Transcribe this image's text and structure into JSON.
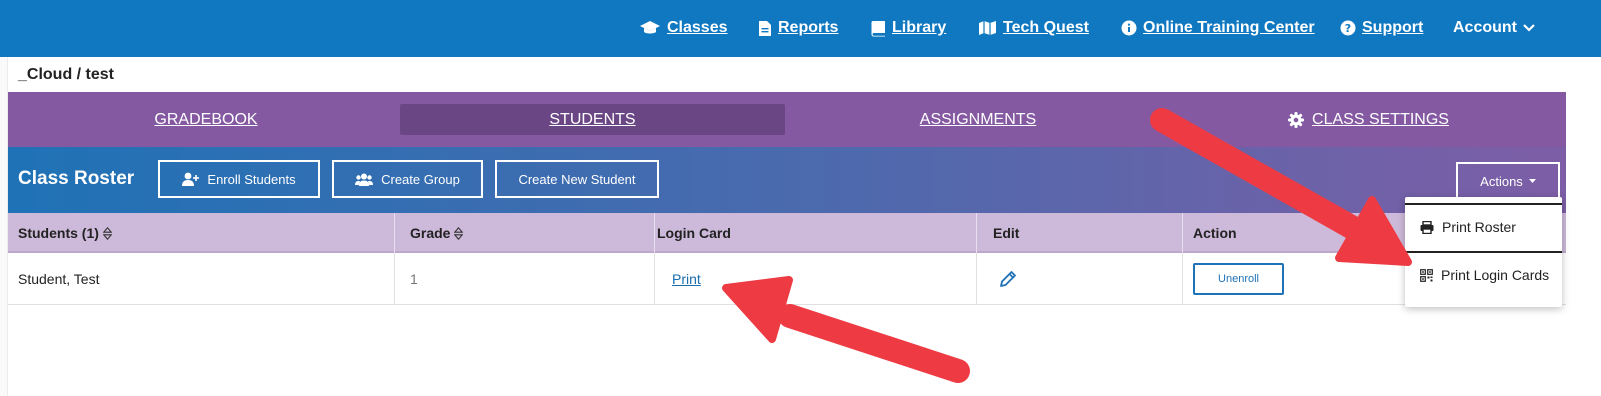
{
  "nav": {
    "classes": "Classes",
    "reports": "Reports",
    "library": "Library",
    "tech_quest": "Tech Quest",
    "training": "Online Training Center",
    "support": "Support",
    "account": "Account"
  },
  "breadcrumb": "_Cloud / test",
  "tabs": {
    "gradebook": "GRADEBOOK",
    "students": "STUDENTS",
    "assignments": "ASSIGNMENTS",
    "settings": "CLASS SETTINGS"
  },
  "roster": {
    "title": "Class Roster",
    "enroll": "Enroll Students",
    "create_group": "Create Group",
    "create_student": "Create New Student",
    "actions": "Actions"
  },
  "table": {
    "headers": {
      "students": "Students (1)",
      "grade": "Grade",
      "login_card": "Login Card",
      "edit": "Edit",
      "action": "Action"
    },
    "rows": [
      {
        "student": "Student, Test",
        "grade": "1",
        "login_card": "Print",
        "action": "Unenroll"
      }
    ]
  },
  "dropdown": {
    "print_roster": "Print Roster",
    "print_login_cards": "Print Login Cards"
  },
  "colors": {
    "nav_blue": "#0f78c0",
    "tab_purple": "#8459a2",
    "active_tab": "#6b4685",
    "table_header": "#cdb9d9",
    "annotation_red": "#ee3b43"
  }
}
